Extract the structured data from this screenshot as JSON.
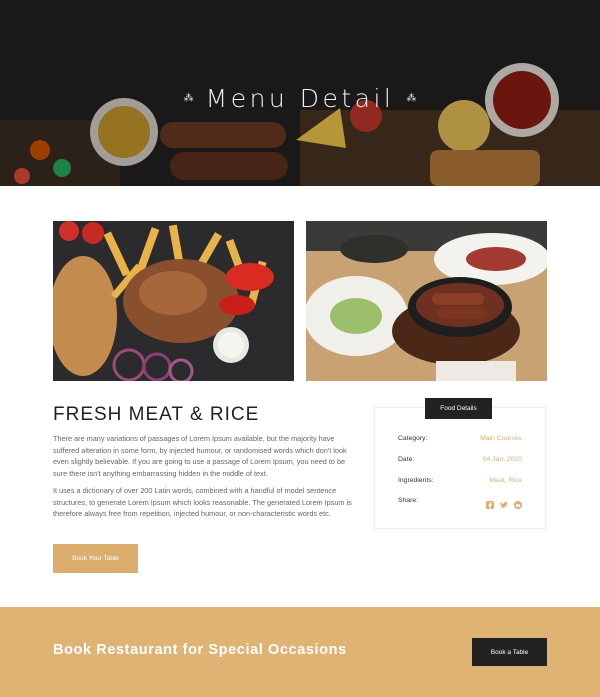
{
  "hero": {
    "title": "Menu Detail",
    "ornament_left": "⁂",
    "ornament_right": "⁂"
  },
  "dish": {
    "title": "FRESH MEAT & RICE",
    "paragraph_1": "There are many variations of passages of Lorem Ipsum available, but the majority have suffered alteration in some form, by injected humour, or randomised words which don't look even slightly believable. If you are going to use a passage of Lorem Ipsum, you need to be sure there isn't anything embarrassing hidden in the middle of text.",
    "paragraph_2": "It uses a dictionary of over 200 Latin words, combined with a handful of model sentence structures, to generate Lorem Ipsum which looks reasonable. The generated Lorem Ipsum is therefore always free from repetition, injected humour, or non-characteristic words etc.",
    "book_button": "Book Your Table"
  },
  "details": {
    "tag": "Food Details",
    "rows": [
      {
        "label": "Category:",
        "value": "Main Courses"
      },
      {
        "label": "Date:",
        "value": "04 Jan, 2020"
      },
      {
        "label": "Ingredients:",
        "value": "Meat, Rice"
      },
      {
        "label": "Share:"
      }
    ],
    "share_icons": [
      "facebook-icon",
      "twitter-icon",
      "reddit-icon"
    ]
  },
  "band": {
    "title": "Book Restaurant for Special Occasions",
    "button": "Book a Table"
  },
  "colors": {
    "accent": "#dcae6e",
    "band": "#dfb374",
    "dark": "#222222"
  }
}
